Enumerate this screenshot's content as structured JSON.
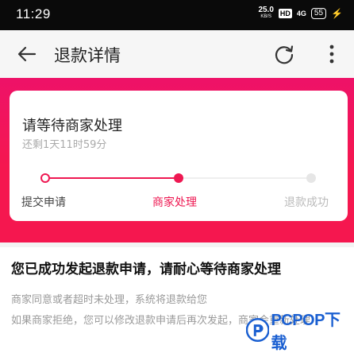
{
  "status_bar": {
    "time": "11:29",
    "net_speed_value": "25.0",
    "net_speed_unit": "KB/S",
    "hd_badge": "HD",
    "signal": "4G",
    "battery": "55"
  },
  "header": {
    "title": "退款详情",
    "back_icon": "arrow-left-icon",
    "refresh_icon": "refresh-icon",
    "more_icon": "more-vertical-icon"
  },
  "status_card": {
    "title": "请等待商家处理",
    "remaining": "还剩1天11时59分",
    "steps": [
      {
        "label": "提交申请",
        "state": "done"
      },
      {
        "label": "商家处理",
        "state": "current"
      },
      {
        "label": "退款成功",
        "state": "pending"
      }
    ],
    "current_step_index": 1
  },
  "info": {
    "headline": "您已成功发起退款申请，请耐心等待商家处理",
    "line1": "商家同意或者超时未处理，系统将退款给您",
    "line2": "如果商家拒绝，您可以修改退款申请后再次发起，商家会重新处理"
  },
  "watermark": {
    "text": "PCPOP下载"
  },
  "colors": {
    "accent": "#ee1852",
    "hero_gradient_top": "#ee1268",
    "status_bar_bg": "#0a0a0a"
  }
}
